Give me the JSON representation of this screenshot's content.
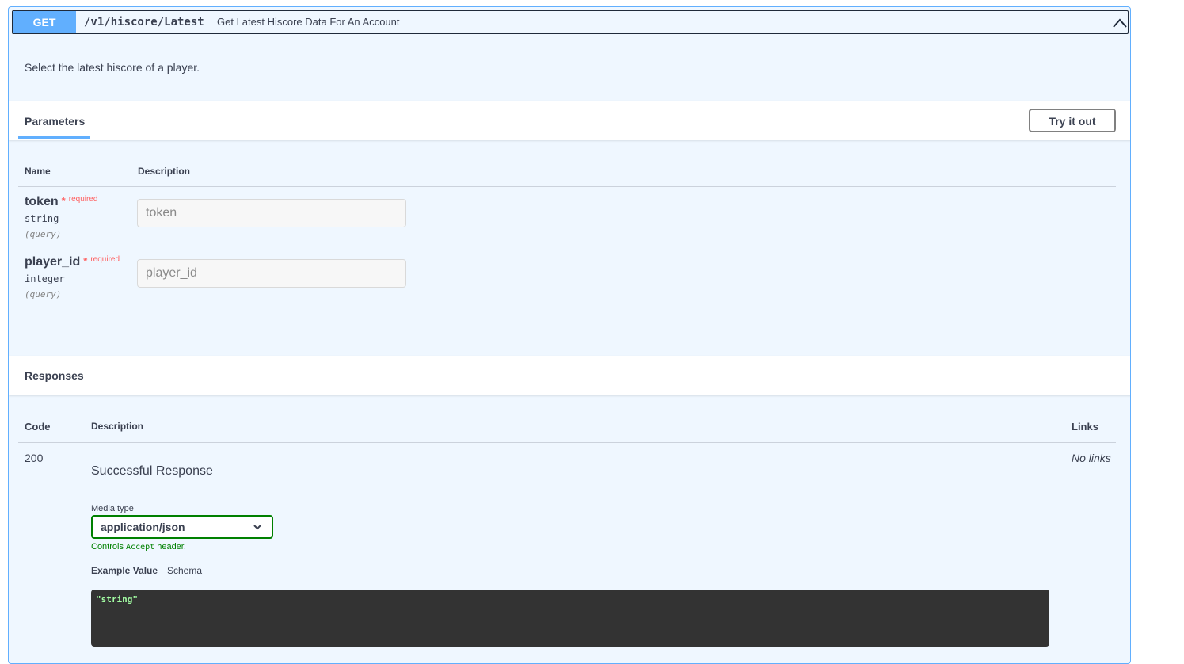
{
  "operation": {
    "method": "GET",
    "path": "/v1/hiscore/Latest",
    "summary": "Get Latest Hiscore Data For An Account",
    "description": "Select the latest hiscore of a player.",
    "colors": {
      "method_bg": "#61affe",
      "block_bg": "#eff7ff",
      "required": "#ff6060",
      "success": "#008000"
    }
  },
  "parameters": {
    "tab_label": "Parameters",
    "try_button": "Try it out",
    "col_name": "Name",
    "col_description": "Description",
    "items": [
      {
        "name": "token",
        "required_star": "*",
        "required_label": "required",
        "type": "string",
        "in": "(query)",
        "placeholder": "token"
      },
      {
        "name": "player_id",
        "required_star": "*",
        "required_label": "required",
        "type": "integer",
        "in": "(query)",
        "placeholder": "player_id"
      }
    ]
  },
  "responses": {
    "title": "Responses",
    "col_code": "Code",
    "col_description": "Description",
    "col_links": "Links",
    "items": [
      {
        "code": "200",
        "description": "Successful Response",
        "links": "No links",
        "media_type_label": "Media type",
        "media_type_value": "application/json",
        "controls_prefix": "Controls",
        "controls_code": "Accept",
        "controls_suffix": "header.",
        "tab_example": "Example Value",
        "tab_schema": "Schema",
        "example": "\"string\""
      }
    ]
  },
  "icons": {
    "collapse": "chevron-up-icon",
    "dropdown": "chevron-down-icon"
  }
}
